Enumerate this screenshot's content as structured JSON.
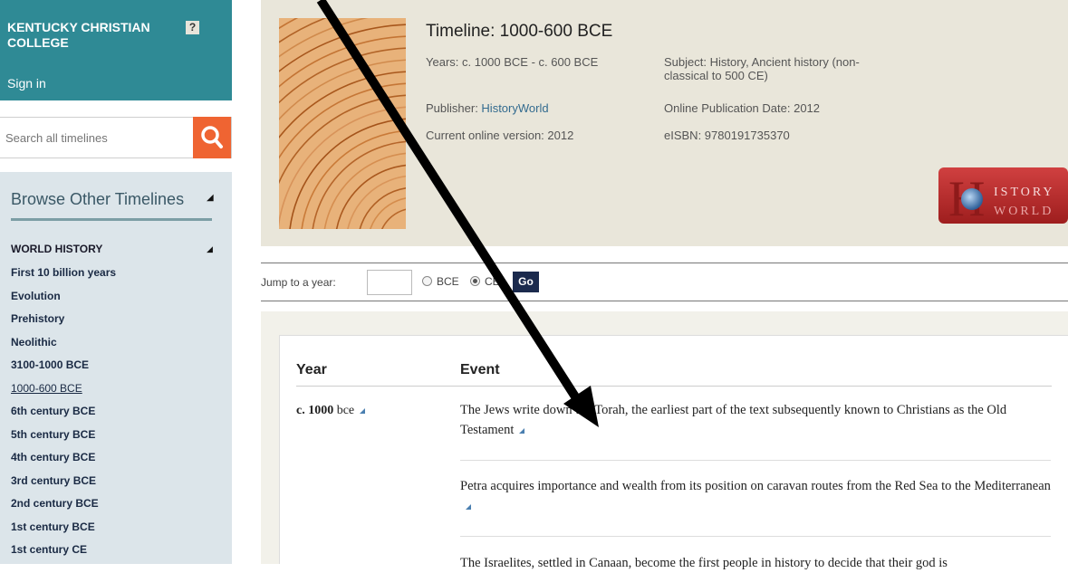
{
  "institution": {
    "name": "KENTUCKY CHRISTIAN COLLEGE",
    "help_label": "?",
    "signin_label": "Sign in"
  },
  "search": {
    "placeholder": "Search all timelines",
    "button_icon": "search-icon"
  },
  "browse": {
    "title": "Browse Other Timelines",
    "section_title": "WORLD HISTORY",
    "items": [
      "First 10 billion years",
      "Evolution",
      "Prehistory",
      "Neolithic",
      "3100-1000 BCE",
      "1000-600 BCE",
      "6th century BCE",
      "5th century BCE",
      "4th century BCE",
      "3rd century BCE",
      "2nd century BCE",
      "1st century BCE",
      "1st century CE"
    ],
    "current_item": "1000-600 BCE"
  },
  "header": {
    "title": "Timeline: 1000-600 BCE",
    "years": "Years: c. 1000 BCE - c. 600 BCE",
    "publisher_label": "Publisher: ",
    "publisher_link": "HistoryWorld",
    "current_version": "Current online version: 2012",
    "subject_line1": "Subject: History, Ancient history (non-",
    "subject_line2": "classical to 500 CE)",
    "online_pub_date": "Online Publication Date: 2012",
    "eisbn": "eISBN: 9780191735370",
    "logo_text_top": "ISTORY",
    "logo_text_bottom": "WORLD",
    "logo_letter": "H"
  },
  "jump": {
    "label": "Jump to a year:",
    "bce_label": "BCE",
    "ce_label": "CE",
    "selected": "CE",
    "go_label": "Go"
  },
  "table": {
    "year_header": "Year",
    "event_header": "Event",
    "year_value_bold": "c. 1000",
    "year_value_suffix": " bce",
    "events": [
      "The Jews write down the Torah, the earliest part of the text subsequently known to Christians as the Old Testament",
      "Petra acquires importance and wealth from its position on caravan routes from the Red Sea to the Mediterranean",
      "The Israelites, settled in Canaan, become the first people in history to decide that their god is"
    ]
  },
  "colors": {
    "teal": "#2f8a95",
    "orange": "#ef6432",
    "navy": "#1b2a4d",
    "sidebar_bg": "#dce5ea",
    "header_bg": "#e9e6da"
  }
}
